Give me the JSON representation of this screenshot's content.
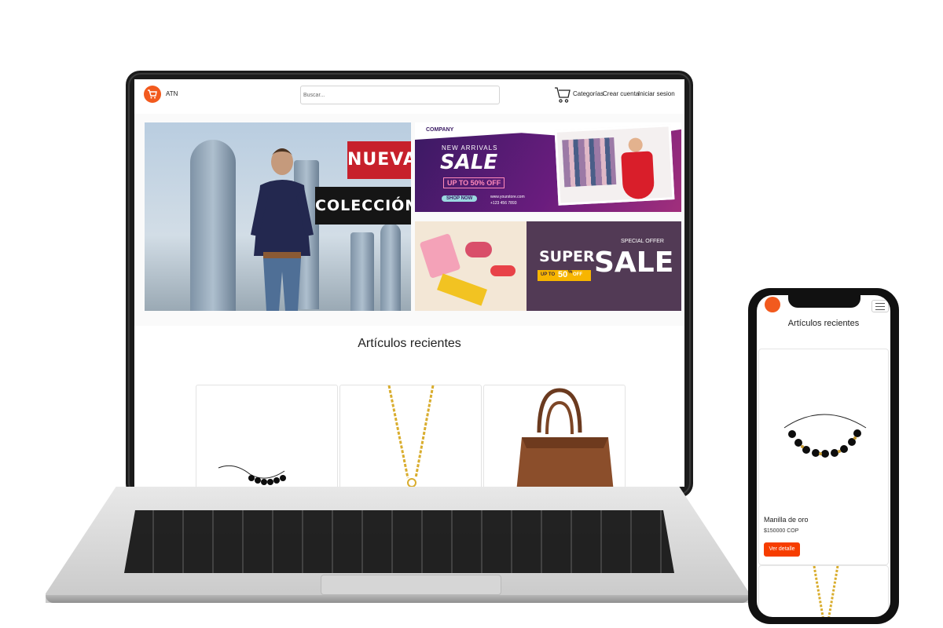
{
  "site": {
    "brand": "ATN",
    "search_placeholder": "Buscar...",
    "nav_links": [
      "Categorías",
      "Crear cuenta",
      "Iniciar sesion"
    ]
  },
  "hero": {
    "main_banner": {
      "tag1": "NUEVA",
      "tag2": "COLECCIÓN"
    },
    "top_banner": {
      "company": "COMPANY",
      "headline": "NEW ARRIVALS",
      "big": "SALE",
      "discount": "UP TO 50% OFF",
      "cta": "SHOP NOW",
      "website": "www.yourstore.com",
      "phone": "+123 456 7893"
    },
    "bottom_banner": {
      "special": "SPECIAL OFFER",
      "super": "SUPER",
      "sale": "SALE",
      "upto": "UP TO",
      "pct": "50",
      "pct_unit": "%",
      "off": "OFF"
    }
  },
  "recent": {
    "title": "Artículos recientes"
  },
  "mobile": {
    "title": "Artículos recientes",
    "product": {
      "name": "Manilla de oro",
      "price": "$150000 COP",
      "button": "Ver detalle"
    }
  },
  "colors": {
    "accent": "#f25a1e",
    "button": "#f63d00",
    "nueva_bg": "#c7202b",
    "coleccion_bg": "#151515"
  },
  "icons": [
    "cart-logo-icon",
    "shopping-cart-icon",
    "hamburger-menu-icon"
  ]
}
